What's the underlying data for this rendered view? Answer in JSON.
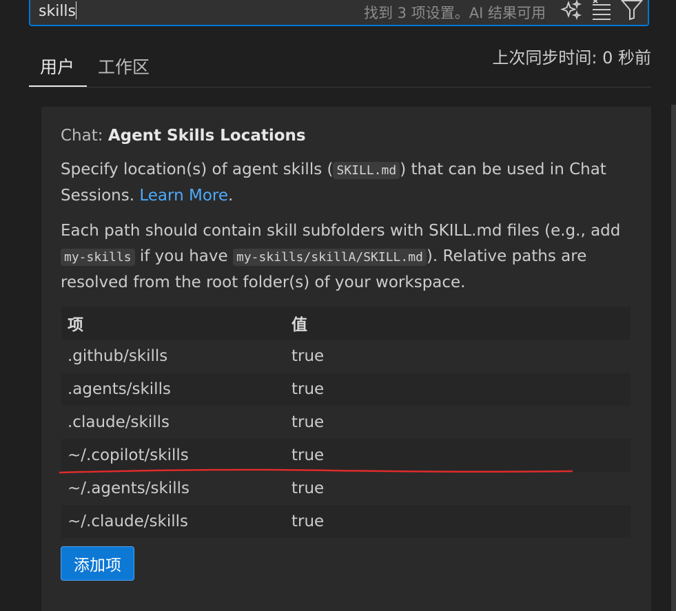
{
  "search": {
    "value": "skills",
    "result_count": "找到 3 项设置。AI 结果可用",
    "icons": [
      "sparkle-icon",
      "clear-filter-icon",
      "filter-icon"
    ]
  },
  "tabs": [
    {
      "label": "用户",
      "active": true
    },
    {
      "label": "工作区",
      "active": false
    }
  ],
  "sync_status": "上次同步时间: 0 秒前",
  "setting": {
    "category": "Chat: ",
    "name": "Agent Skills Locations",
    "desc1_before": "Specify location(s) of agent skills (",
    "desc1_code": "SKILL.md",
    "desc1_after": ") that can be used in Chat Sessions. ",
    "desc1_link": "Learn More",
    "desc1_end": ".",
    "desc2_a": "Each path should contain skill subfolders with SKILL.md files (e.g., add ",
    "desc2_code1": "my-skills",
    "desc2_b": " if you have ",
    "desc2_code2": "my-skills/skillA/SKILL.md",
    "desc2_c": "). Relative paths are resolved from the root folder(s) of your workspace."
  },
  "table": {
    "header": {
      "key": "项",
      "value": "值"
    },
    "rows": [
      {
        "key": ".github/skills",
        "value": "true"
      },
      {
        "key": ".agents/skills",
        "value": "true"
      },
      {
        "key": ".claude/skills",
        "value": "true"
      },
      {
        "key": "~/.copilot/skills",
        "value": "true"
      },
      {
        "key": "~/.agents/skills",
        "value": "true"
      },
      {
        "key": "~/.claude/skills",
        "value": "true"
      }
    ]
  },
  "add_button_label": "添加项",
  "colors": {
    "accent": "#0078d4",
    "link": "#4daafc",
    "annotation": "#e02b2b"
  }
}
